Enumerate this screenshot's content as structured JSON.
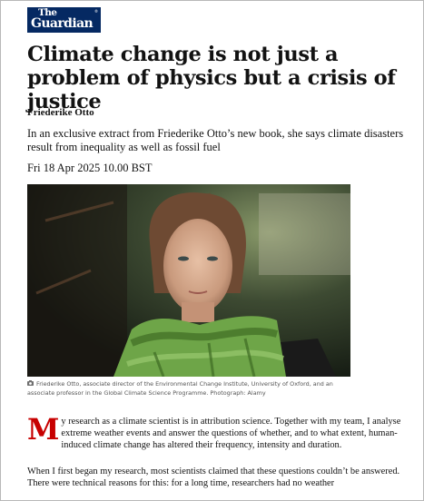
{
  "masthead": {
    "line1": "The",
    "line2": "Guardian",
    "mark": "®",
    "background": "#052962"
  },
  "article": {
    "headline": "Climate change is not just a problem of physics but a crisis of justice",
    "byline": "Friederike Otto",
    "standfirst": "In an exclusive extract from Friederike Otto’s new book, she says climate disasters result from inequality as well as fossil fuel",
    "dateline": "Fri 18 Apr 2025 10.00 BST",
    "image": {
      "icon": "camera-icon",
      "caption": "Friederike Otto, associate director of the Environmental Change Institute, University of Oxford, and an associate professor in the Global Climate Science Programme. Photograph: Alamy"
    },
    "body": {
      "dropcap": "M",
      "dropcap_color": "#c70000",
      "p1_rest": "y research as a climate scientist is in attribution science. Together with my team, I analyse extreme weather events and answer the questions of whether, and to what extent, human-induced climate change has altered their frequency, intensity and duration.",
      "p2": "When I first began my research, most scientists claimed that these questions couldn’t be answered. There were technical reasons for this: for a long time, researchers had no weather"
    }
  }
}
